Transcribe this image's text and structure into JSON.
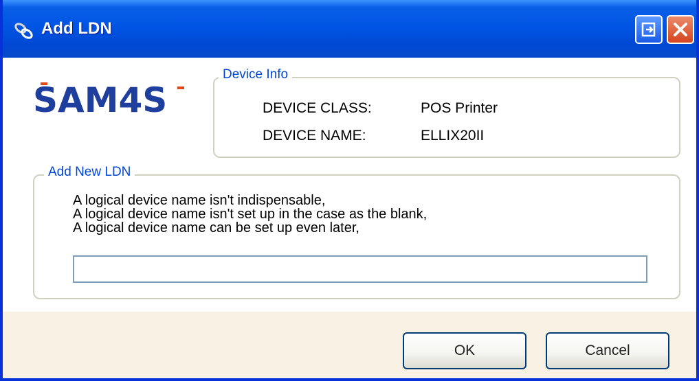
{
  "window": {
    "title": "Add LDN"
  },
  "titlebar": {
    "icon": "link-icon",
    "restore_icon": "restore-icon",
    "close_icon": "close-icon"
  },
  "logo": {
    "text": "SAM4S",
    "icon": "sam4s-logo"
  },
  "device_info": {
    "legend": "Device Info",
    "class_label": "DEVICE CLASS:",
    "class_value": "POS Printer",
    "name_label": "DEVICE NAME:",
    "name_value": "ELLIX20II"
  },
  "add_ldn": {
    "legend": "Add New LDN",
    "line1": "A logical device name isn't indispensable,",
    "line2": "A logical device name isn't set up in the case as the blank,",
    "line3": "A logical device name can be set up even later,",
    "input_value": ""
  },
  "buttons": {
    "ok": "OK",
    "cancel": "Cancel"
  },
  "colors": {
    "title_bar": "#0054e3",
    "legend_text": "#0046d5",
    "logo_blue": "#1f3f9f",
    "logo_accent": "#e04a1a",
    "footer_bg": "#f9f1e4"
  }
}
